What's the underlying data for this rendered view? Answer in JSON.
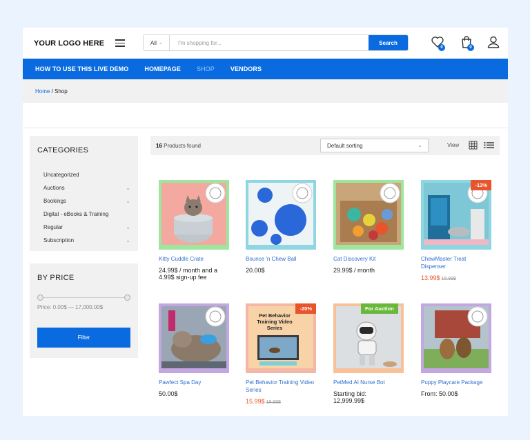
{
  "header": {
    "logo": "YOUR LOGO HERE",
    "search_category": "All",
    "search_placeholder": "I'm shopping for...",
    "search_button": "Search",
    "wishlist_count": "0",
    "cart_count": "0"
  },
  "nav": {
    "items": [
      {
        "label": "HOW TO USE THIS LIVE DEMO"
      },
      {
        "label": "HOMEPAGE"
      },
      {
        "label": "SHOP"
      },
      {
        "label": "VENDORS"
      }
    ]
  },
  "breadcrumb": {
    "home": "Home",
    "separator": " / ",
    "current": "Shop"
  },
  "sidebar": {
    "categories_title": "CATEGORIES",
    "categories": [
      {
        "label": "Uncategorized"
      },
      {
        "label": "Auctions"
      },
      {
        "label": "Bookings"
      },
      {
        "label": "Digital - eBooks & Training"
      },
      {
        "label": "Regular"
      },
      {
        "label": "Subscription"
      }
    ],
    "price_title": "BY PRICE",
    "price_label": "Price: 0.00$ — 17,000.00$",
    "filter_button": "Filter"
  },
  "toolbar": {
    "count": "16",
    "found_text": "Products found",
    "sort": "Default sorting",
    "view_label": "View"
  },
  "products": [
    {
      "name": "Kitty Cuddle Crate",
      "price": "24.99$ / month and a 4.99$ sign-up fee"
    },
    {
      "name": "Bounce 'n Chew Ball",
      "price": "20.00$"
    },
    {
      "name": "Cat Discovery Kit",
      "price": "29.99$ / month"
    },
    {
      "name": "ChewMaster Treat Dispenser",
      "price": "13.99$",
      "old_price": "15.99$",
      "tag": "-13%"
    },
    {
      "name": "Pawfect Spa Day",
      "price": "50.00$"
    },
    {
      "name": "Pet Behavior Training Video Series",
      "price": "15.99$",
      "old_price": "19.99$",
      "tag": "-20%",
      "thumb_text": "Pet Behavior Training Video Series"
    },
    {
      "name": "PetMed AI Nurse Bot",
      "price": "Starting bid: 12,999.99$",
      "tag": "For Auction"
    },
    {
      "name": "Puppy Playcare Package",
      "price": "From: 50.00$"
    }
  ],
  "colors": {
    "accent": "#0a6be0",
    "sale": "#e8542b",
    "auction": "#69b83a"
  }
}
